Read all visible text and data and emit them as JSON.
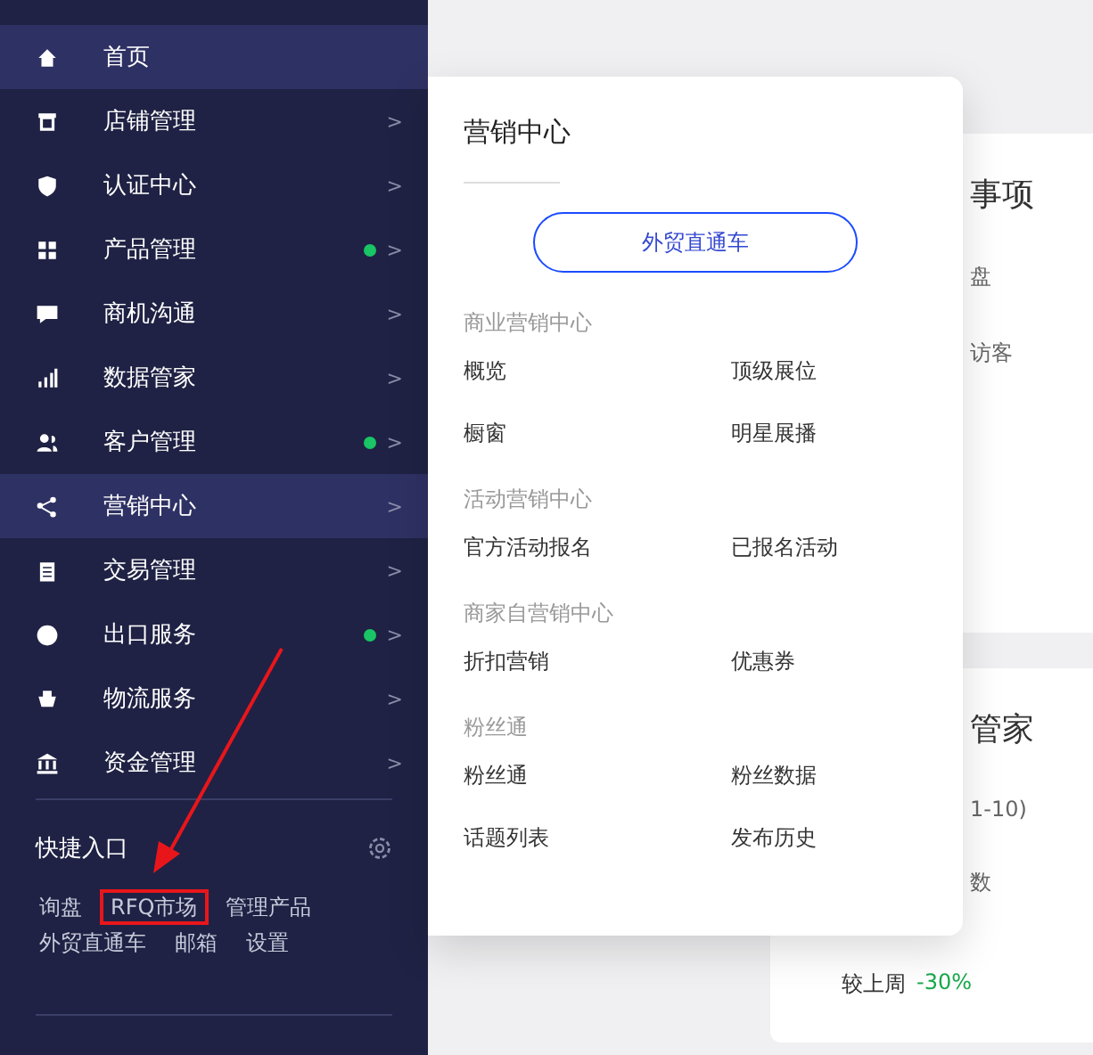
{
  "sidebar": {
    "items": [
      {
        "label": "首页",
        "selected": true,
        "dot": false
      },
      {
        "label": "店铺管理",
        "selected": false,
        "dot": false,
        "chevron": ">"
      },
      {
        "label": "认证中心",
        "selected": false,
        "dot": false,
        "chevron": ">"
      },
      {
        "label": "产品管理",
        "selected": false,
        "dot": true,
        "chevron": ">"
      },
      {
        "label": "商机沟通",
        "selected": false,
        "dot": false,
        "chevron": ">"
      },
      {
        "label": "数据管家",
        "selected": false,
        "dot": false,
        "chevron": ">"
      },
      {
        "label": "客户管理",
        "selected": false,
        "dot": true,
        "chevron": ">"
      },
      {
        "label": "营销中心",
        "selected": true,
        "dot": false,
        "chevron": ">"
      },
      {
        "label": "交易管理",
        "selected": false,
        "dot": false,
        "chevron": ">"
      },
      {
        "label": "出口服务",
        "selected": false,
        "dot": true,
        "chevron": ">"
      },
      {
        "label": "物流服务",
        "selected": false,
        "dot": false,
        "chevron": ">"
      },
      {
        "label": "资金管理",
        "selected": false,
        "dot": false,
        "chevron": ">"
      }
    ],
    "quick": {
      "title": "快捷入口",
      "links": [
        {
          "label": "询盘",
          "highlighted": false
        },
        {
          "label": "RFQ市场",
          "highlighted": true
        },
        {
          "label": "管理产品",
          "highlighted": false
        },
        {
          "label": "外贸直通车",
          "highlighted": false
        },
        {
          "label": "邮箱",
          "highlighted": false
        },
        {
          "label": "设置",
          "highlighted": false
        }
      ]
    }
  },
  "main": {
    "cards": [
      {
        "title": "事项",
        "lines": [
          "盘",
          "访客"
        ]
      },
      {
        "title": "管家",
        "lines": [
          "1-10)",
          "数"
        ],
        "footer": "较上周",
        "change": "-30%"
      }
    ]
  },
  "popup": {
    "title": "营销中心",
    "button": "外贸直通车",
    "sections": [
      {
        "heading": "商业营销中心",
        "links": [
          "概览",
          "顶级展位",
          "橱窗",
          "明星展播"
        ]
      },
      {
        "heading": "活动营销中心",
        "links": [
          "官方活动报名",
          "已报名活动"
        ]
      },
      {
        "heading": "商家自营销中心",
        "links": [
          "折扣营销",
          "优惠券"
        ]
      },
      {
        "heading": "粉丝通",
        "links": [
          "粉丝通",
          "粉丝数据",
          "话题列表",
          "发布历史"
        ]
      }
    ]
  }
}
